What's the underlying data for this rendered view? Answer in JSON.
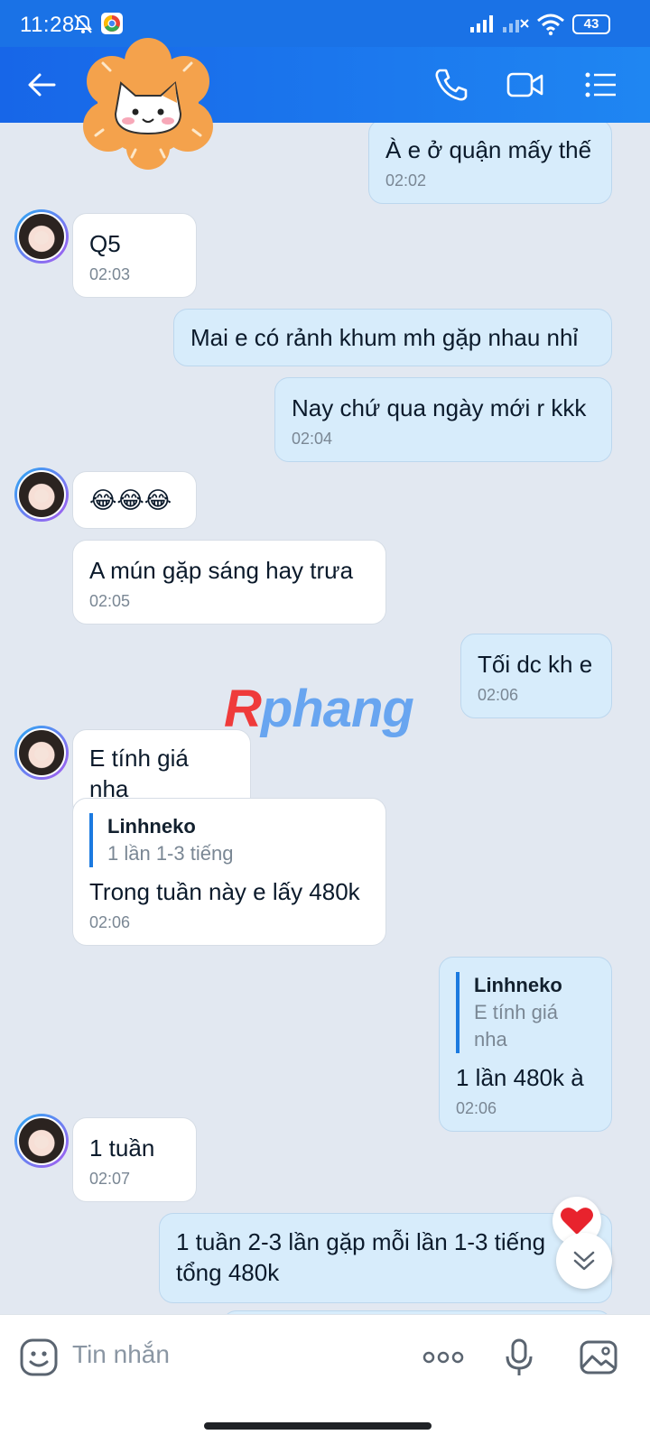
{
  "status_bar": {
    "time": "11:28",
    "battery": "43"
  },
  "header": {
    "back_icon": "arrow-left-icon",
    "call_icon": "phone-icon",
    "video_icon": "video-camera-icon",
    "menu_icon": "list-menu-icon"
  },
  "watermark": {
    "first": "R",
    "rest": "phang"
  },
  "messages": [
    {
      "dir": "out",
      "text": "À e ở quận mấy thế",
      "time": "02:02"
    },
    {
      "dir": "in",
      "text": "Q5",
      "time": "02:03"
    },
    {
      "dir": "out",
      "text": "Mai e có rảnh khum mh gặp nhau nhỉ",
      "time": ""
    },
    {
      "dir": "out",
      "text": "Nay chứ qua ngày mới r kkk",
      "time": "02:04"
    },
    {
      "dir": "in",
      "text": "😂😂😂",
      "time": ""
    },
    {
      "dir": "in",
      "text": "A mún gặp sáng hay trưa",
      "time": "02:05"
    },
    {
      "dir": "out",
      "text": "Tối dc kh e",
      "time": "02:06"
    },
    {
      "dir": "in",
      "text": "E tính giá nha",
      "time": ""
    },
    {
      "dir": "in",
      "quote_name": "Linhneko",
      "quote_text": "1 lần 1-3 tiếng",
      "text": "Trong tuần này e lấy 480k",
      "time": "02:06"
    },
    {
      "dir": "out",
      "quote_name": "Linhneko",
      "quote_text": "E tính giá nha",
      "text": "1 lần 480k à",
      "time": "02:06"
    },
    {
      "dir": "in",
      "text": "1 tuần",
      "time": "02:07"
    },
    {
      "dir": "out",
      "text": "1 tuần 2-3 lần gặp mỗi lần 1-3 tiếng tổng 480k",
      "time": ""
    }
  ],
  "input": {
    "placeholder": "Tin nhắn"
  }
}
